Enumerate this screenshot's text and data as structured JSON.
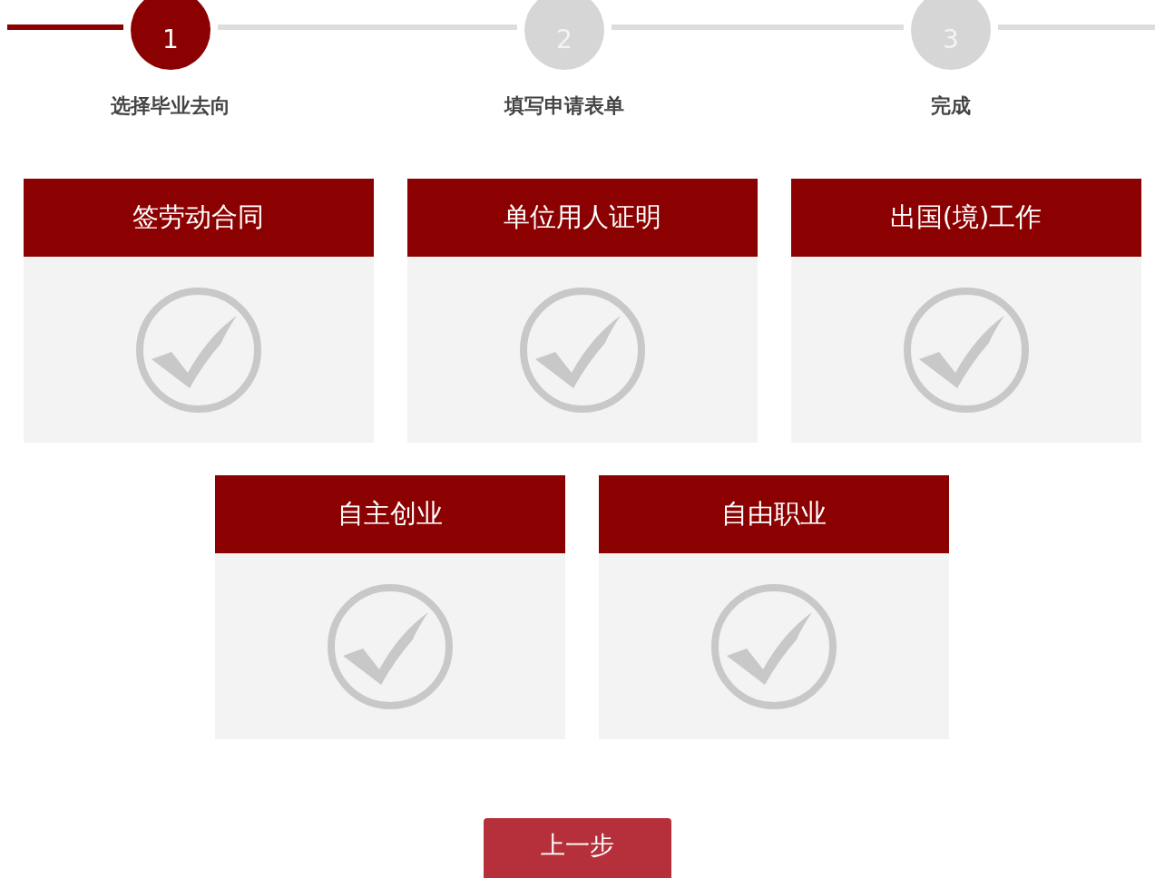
{
  "steps": [
    {
      "number": "1",
      "label": "选择毕业去向",
      "selected": true
    },
    {
      "number": "2",
      "label": "填写申请表单",
      "selected": false
    },
    {
      "number": "3",
      "label": "完成",
      "selected": false
    }
  ],
  "options": [
    {
      "title": "签劳动合同"
    },
    {
      "title": "单位用人证明"
    },
    {
      "title": "出国(境)工作"
    },
    {
      "title": "自主创业"
    },
    {
      "title": "自由职业"
    }
  ],
  "back_button": "上一步"
}
